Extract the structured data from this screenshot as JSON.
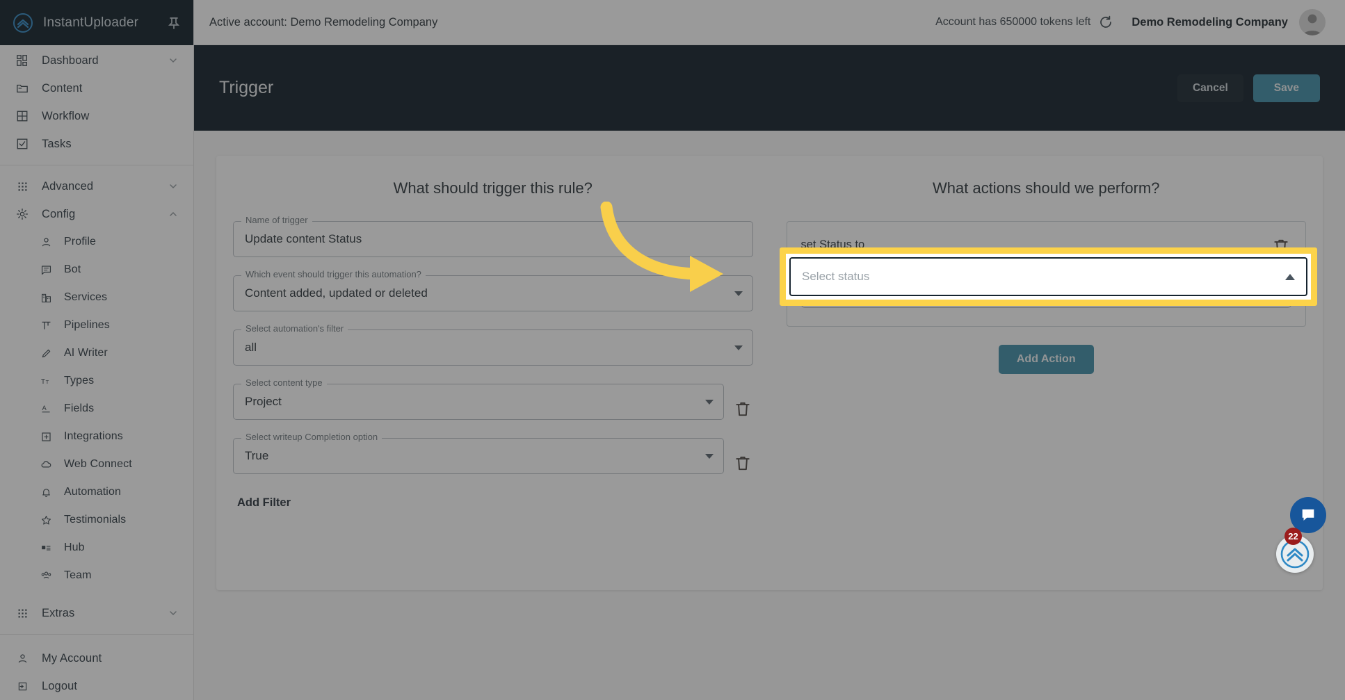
{
  "brand": {
    "name": "InstantUploader",
    "logo_icon": "double-chevron-up-circle-icon",
    "pin_icon": "pin-icon"
  },
  "sidebar": {
    "primary": [
      {
        "label": "Dashboard",
        "icon": "dashboard-grid-icon",
        "expandable": true,
        "expanded": false
      },
      {
        "label": "Content",
        "icon": "folder-icon",
        "expandable": false
      },
      {
        "label": "Workflow",
        "icon": "table-grid-icon",
        "expandable": false
      },
      {
        "label": "Tasks",
        "icon": "checkbox-icon",
        "expandable": false
      }
    ],
    "groups": [
      {
        "label": "Advanced",
        "icon": "apps-grid-icon",
        "expandable": true,
        "expanded": false
      },
      {
        "label": "Config",
        "icon": "gear-icon",
        "expandable": true,
        "expanded": true
      }
    ],
    "config_items": [
      {
        "label": "Profile",
        "icon": "person-icon"
      },
      {
        "label": "Bot",
        "icon": "chat-lines-icon"
      },
      {
        "label": "Services",
        "icon": "building-icon"
      },
      {
        "label": "Pipelines",
        "icon": "pipeline-icon"
      },
      {
        "label": "AI Writer",
        "icon": "pencil-icon"
      },
      {
        "label": "Types",
        "icon": "text-format-icon"
      },
      {
        "label": "Fields",
        "icon": "field-letter-icon"
      },
      {
        "label": "Integrations",
        "icon": "plus-square-icon"
      },
      {
        "label": "Web Connect",
        "icon": "cloud-icon"
      },
      {
        "label": "Automation",
        "icon": "bell-icon"
      },
      {
        "label": "Testimonials",
        "icon": "star-icon"
      },
      {
        "label": "Hub",
        "icon": "article-icon"
      },
      {
        "label": "Team",
        "icon": "people-group-icon"
      }
    ],
    "extras": {
      "label": "Extras",
      "icon": "apps-grid-icon",
      "expandable": true,
      "expanded": false
    },
    "footer": [
      {
        "label": "My Account",
        "icon": "person-icon"
      },
      {
        "label": "Logout",
        "icon": "logout-icon"
      }
    ]
  },
  "topbar": {
    "active_account": "Active account: Demo Remodeling Company",
    "tokens_text": "Account has 650000 tokens left",
    "refresh_icon": "refresh-icon",
    "company": "Demo Remodeling Company",
    "avatar_icon": "avatar-icon"
  },
  "pagehead": {
    "title": "Trigger",
    "cancel_label": "Cancel",
    "save_label": "Save"
  },
  "trigger_panel": {
    "heading": "What should trigger this rule?",
    "fields": [
      {
        "legend": "Name of trigger",
        "value": "Update content Status",
        "type": "text",
        "has_caret": false,
        "has_trash": false
      },
      {
        "legend": "Which event should trigger this automation?",
        "value": "Content added, updated or deleted",
        "type": "select",
        "has_caret": true,
        "has_trash": false
      },
      {
        "legend": "Select automation's filter",
        "value": "all",
        "type": "select",
        "has_caret": true,
        "has_trash": false
      },
      {
        "legend": "Select content type",
        "value": "Project",
        "type": "select",
        "has_caret": true,
        "has_trash": true
      },
      {
        "legend": "Select writeup Completion option",
        "value": "True",
        "type": "select",
        "has_caret": true,
        "has_trash": true
      }
    ],
    "add_filter_label": "Add Filter",
    "trash_icon": "trash-icon"
  },
  "actions_panel": {
    "heading": "What actions should we perform?",
    "action_label": "set Status to",
    "trash_icon": "trash-icon",
    "status_select": {
      "placeholder": "Select status",
      "value": "",
      "expanded": true,
      "caret_icon": "caret-up-icon"
    },
    "add_action_label": "Add Action"
  },
  "annotation": {
    "arrow_color": "#F9CF4B",
    "highlight_border_color": "#FCD34A",
    "target": "status-select-dropdown"
  },
  "chat_widget": {
    "bubble_icon": "chat-icon",
    "launcher_icon": "double-chevron-up-icon",
    "badge_count": "22"
  },
  "colors": {
    "sidebar_header": "#0d1b25",
    "page_header": "#0e1c26",
    "accent": "#3d8ca6",
    "highlight": "#fcd34a",
    "badge": "#9b1c1c",
    "chat_blue": "#17569b"
  }
}
